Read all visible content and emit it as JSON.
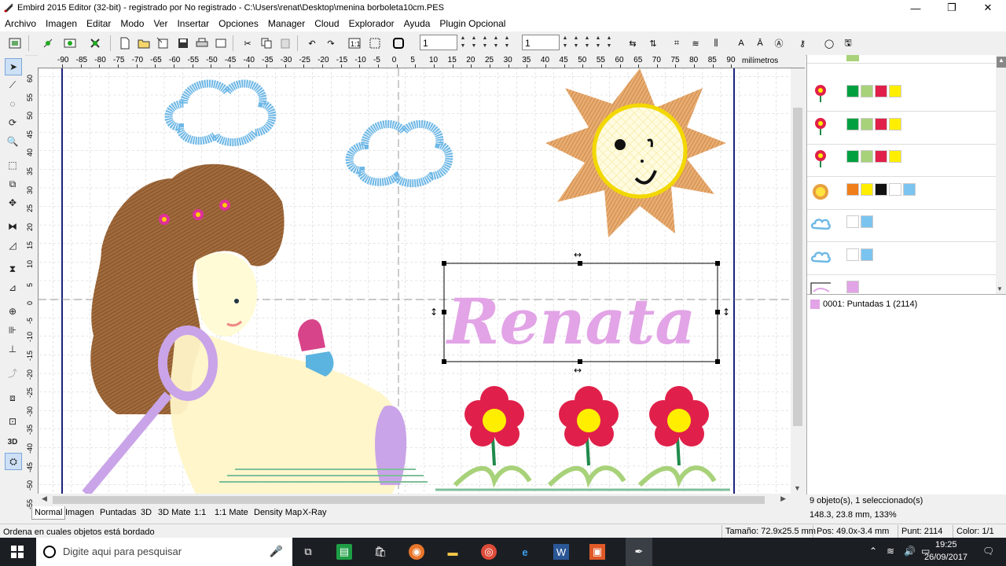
{
  "window": {
    "title": "Embird 2015 Editor (32-bit) - registrado por No registrado - C:\\Users\\renat\\Desktop\\menina borboleta10cm.PES",
    "minimize": "—",
    "maximize": "❐",
    "close": "✕"
  },
  "menu": [
    "Archivo",
    "Imagen",
    "Editar",
    "Modo",
    "Ver",
    "Insertar",
    "Opciones",
    "Manager",
    "Cloud",
    "Explorador",
    "Ayuda",
    "Plugin Opcional"
  ],
  "toolbar": {
    "field1": "1",
    "field2": "1"
  },
  "ruler": {
    "top_labels": [
      "-90",
      "-85",
      "-80",
      "-75",
      "-70",
      "-65",
      "-60",
      "-55",
      "-50",
      "-45",
      "-40",
      "-35",
      "-30",
      "-25",
      "-20",
      "-15",
      "-10",
      "-5",
      "0",
      "5",
      "10",
      "15",
      "20",
      "25",
      "30",
      "35",
      "40",
      "45",
      "50",
      "55",
      "60",
      "65",
      "70",
      "75",
      "80",
      "85",
      "90"
    ],
    "unit": "milímetros",
    "left_labels": [
      "60",
      "55",
      "50",
      "45",
      "40",
      "35",
      "30",
      "25",
      "20",
      "15",
      "10",
      "5",
      "0",
      "-5",
      "-10",
      "-15",
      "-20",
      "-25",
      "-30",
      "-35",
      "-40",
      "-45",
      "-50",
      "-55"
    ]
  },
  "canvas": {
    "name_text": "Renata",
    "name_color": "#e2a4e6",
    "cloud_color": "#6fb8e6",
    "sun_color": "#d9904a",
    "hair_color": "#8b5a33"
  },
  "tabs": [
    "Normal",
    "Imagen",
    "Puntadas",
    "3D",
    "3D Mate",
    "1:1",
    "1:1 Mate",
    "Density Map",
    "X-Ray"
  ],
  "object_rows": [
    {
      "icon": "flower-thumb-icon",
      "colors": [
        "#00a040",
        "#a8d27a",
        "#e0204a",
        "#ffee00"
      ]
    },
    {
      "icon": "flower-thumb-icon",
      "colors": [
        "#00a040",
        "#a8d27a",
        "#e0204a",
        "#ffee00"
      ]
    },
    {
      "icon": "flower-thumb-icon",
      "colors": [
        "#00a040",
        "#a8d27a",
        "#e0204a",
        "#ffee00"
      ]
    },
    {
      "icon": "sun-thumb-icon",
      "colors": [
        "#f07f1b",
        "#ffee00",
        "#111111",
        "#ffffff",
        "#7cc4f0"
      ]
    },
    {
      "icon": "cloud-thumb-icon",
      "colors": [
        "#ffffff",
        "#7cc4f0"
      ]
    },
    {
      "icon": "cloud-thumb-icon",
      "colors": [
        "#ffffff",
        "#7cc4f0"
      ]
    },
    {
      "icon": "text-thumb-icon",
      "colors": [
        "#e2a4e6"
      ]
    }
  ],
  "object_list": {
    "item": "0001:  Puntadas 1 (2114)",
    "item_color": "#e2a4e6"
  },
  "info": {
    "selection": "9 objeto(s), 1 seleccionado(s)",
    "coords": "148.3, 23.8 mm, 133%"
  },
  "status": {
    "left": "Ordena en cuales objetos está bordado",
    "size": "Tamaño: 72.9x25.5 mm",
    "pos": "Pos: 49.0x-3.4 mm",
    "stitches": "Punt: 2114",
    "color": "Color: 1/1"
  },
  "taskbar": {
    "search_placeholder": "Digite aqui para pesquisar",
    "time": "19:25",
    "date": "26/09/2017"
  }
}
